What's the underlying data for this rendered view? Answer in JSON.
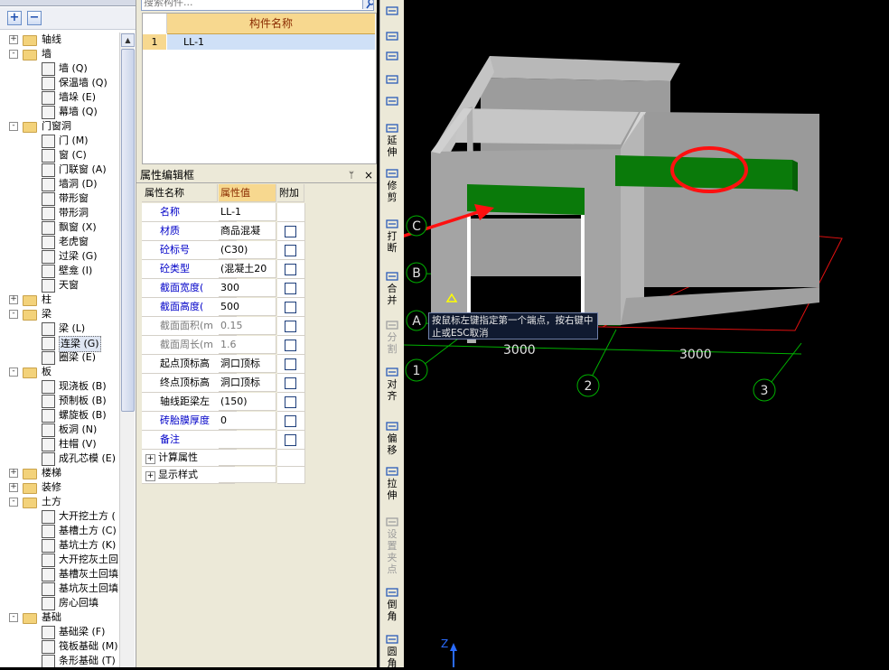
{
  "tree": {
    "items": [
      {
        "level": 0,
        "expand": "+",
        "label": "轴线",
        "folder": true
      },
      {
        "level": 0,
        "expand": "-",
        "label": "墙",
        "folder": true
      },
      {
        "level": 1,
        "label": "墙 (Q)"
      },
      {
        "level": 1,
        "label": "保温墙 (Q)"
      },
      {
        "level": 1,
        "label": "墙垛 (E)"
      },
      {
        "level": 1,
        "label": "幕墙 (Q)"
      },
      {
        "level": 0,
        "expand": "-",
        "label": "门窗洞",
        "folder": true
      },
      {
        "level": 1,
        "label": "门 (M)"
      },
      {
        "level": 1,
        "label": "窗 (C)"
      },
      {
        "level": 1,
        "label": "门联窗 (A)"
      },
      {
        "level": 1,
        "label": "墙洞 (D)"
      },
      {
        "level": 1,
        "label": "带形窗"
      },
      {
        "level": 1,
        "label": "带形洞"
      },
      {
        "level": 1,
        "label": "飘窗 (X)"
      },
      {
        "level": 1,
        "label": "老虎窗"
      },
      {
        "level": 1,
        "label": "过梁 (G)"
      },
      {
        "level": 1,
        "label": "壁龛 (I)"
      },
      {
        "level": 1,
        "label": "天窗"
      },
      {
        "level": 0,
        "expand": "+",
        "label": "柱",
        "folder": true
      },
      {
        "level": 0,
        "expand": "-",
        "label": "梁",
        "folder": true
      },
      {
        "level": 1,
        "label": "梁 (L)"
      },
      {
        "level": 1,
        "label": "连梁 (G)",
        "selected": true
      },
      {
        "level": 1,
        "label": "圈梁 (E)"
      },
      {
        "level": 0,
        "expand": "-",
        "label": "板",
        "folder": true
      },
      {
        "level": 1,
        "label": "现浇板 (B)"
      },
      {
        "level": 1,
        "label": "预制板 (B)"
      },
      {
        "level": 1,
        "label": "螺旋板 (B)"
      },
      {
        "level": 1,
        "label": "板洞 (N)"
      },
      {
        "level": 1,
        "label": "柱帽 (V)"
      },
      {
        "level": 1,
        "label": "成孔芯模 (E)"
      },
      {
        "level": 0,
        "expand": "+",
        "label": "楼梯",
        "folder": true
      },
      {
        "level": 0,
        "expand": "+",
        "label": "装修",
        "folder": true
      },
      {
        "level": 0,
        "expand": "-",
        "label": "土方",
        "folder": true
      },
      {
        "level": 1,
        "label": "大开挖土方 ("
      },
      {
        "level": 1,
        "label": "基槽土方 (C)"
      },
      {
        "level": 1,
        "label": "基坑土方 (K)"
      },
      {
        "level": 1,
        "label": "大开挖灰土回"
      },
      {
        "level": 1,
        "label": "基槽灰土回填"
      },
      {
        "level": 1,
        "label": "基坑灰土回填"
      },
      {
        "level": 1,
        "label": "房心回填"
      },
      {
        "level": 0,
        "expand": "-",
        "label": "基础",
        "folder": true
      },
      {
        "level": 1,
        "label": "基础梁 (F)"
      },
      {
        "level": 1,
        "label": "筏板基础 (M)"
      },
      {
        "level": 1,
        "label": "条形基础 (T)"
      }
    ],
    "add_label": "+",
    "remove_label": "−"
  },
  "search": {
    "placeholder": "搜索构件..."
  },
  "components": {
    "header": "构件名称",
    "rows": [
      {
        "num": "1",
        "name": "LL-1"
      }
    ]
  },
  "properties": {
    "title": "属性编辑框",
    "pin": "ᛘ",
    "close": "×",
    "col_name": "属性名称",
    "col_value": "属性值",
    "col_extra": "附加",
    "rows": [
      {
        "name": "名称",
        "value": "LL-1",
        "style": "blue",
        "check": false
      },
      {
        "name": "材质",
        "value": "商品混凝",
        "style": "blue",
        "check": true
      },
      {
        "name": "砼标号",
        "value": "(C30)",
        "style": "blue",
        "check": true
      },
      {
        "name": "砼类型",
        "value": "(混凝土20",
        "style": "blue",
        "check": true
      },
      {
        "name": "截面宽度(",
        "value": "300",
        "style": "blue",
        "check": true
      },
      {
        "name": "截面高度(",
        "value": "500",
        "style": "blue",
        "check": true
      },
      {
        "name": "截面面积(m",
        "value": "0.15",
        "style": "grey",
        "check": true
      },
      {
        "name": "截面周长(m",
        "value": "1.6",
        "style": "grey",
        "check": true
      },
      {
        "name": "起点顶标高",
        "value": "洞口顶标",
        "style": "blk",
        "check": true
      },
      {
        "name": "终点顶标高",
        "value": "洞口顶标",
        "style": "blk",
        "check": true
      },
      {
        "name": "轴线距梁左",
        "value": "(150)",
        "style": "blk",
        "check": true
      },
      {
        "name": "砖胎膜厚度",
        "value": "0",
        "style": "blue",
        "check": true
      },
      {
        "name": "备注",
        "value": "",
        "style": "blue",
        "check": true
      }
    ],
    "groups": [
      {
        "label": "计算属性"
      },
      {
        "label": "显示样式"
      }
    ]
  },
  "vtoolbar": [
    {
      "label": "",
      "icon": "pen-icon"
    },
    {
      "label": "",
      "icon": "scissor-icon"
    },
    {
      "label": "",
      "icon": "mirror-icon"
    },
    {
      "label": "",
      "icon": "move-icon"
    },
    {
      "label": "",
      "icon": "rotate-icon"
    },
    {
      "label": "延伸",
      "icon": "extend-icon"
    },
    {
      "label": "修剪",
      "icon": "trim-icon"
    },
    {
      "label": "打断",
      "icon": "break-icon"
    },
    {
      "label": "合并",
      "icon": "merge-icon"
    },
    {
      "label": "分割",
      "icon": "split-icon",
      "disabled": true
    },
    {
      "label": "对齐",
      "icon": "align-icon"
    },
    {
      "label": "偏移",
      "icon": "offset-icon"
    },
    {
      "label": "拉伸",
      "icon": "stretch-icon"
    },
    {
      "label": "设置夹点",
      "icon": "grip-icon",
      "disabled": true
    },
    {
      "label": "倒角",
      "icon": "chamfer-icon"
    },
    {
      "label": "圆角",
      "icon": "fillet-icon"
    }
  ],
  "viewport": {
    "axis_labels": {
      "c": "C",
      "b": "B",
      "a": "A",
      "n1": "1",
      "n2": "2",
      "n3": "3"
    },
    "dim1": "3000",
    "dim2": "3000",
    "tooltip": "按鼠标左键指定第一个端点，按右键中止或ESC取消",
    "z_label": "Z",
    "colors": {
      "wall": "#a8a8a8",
      "beam": "#0a7a0a",
      "axis": "#00c000",
      "highlight": "#ff1010"
    }
  }
}
